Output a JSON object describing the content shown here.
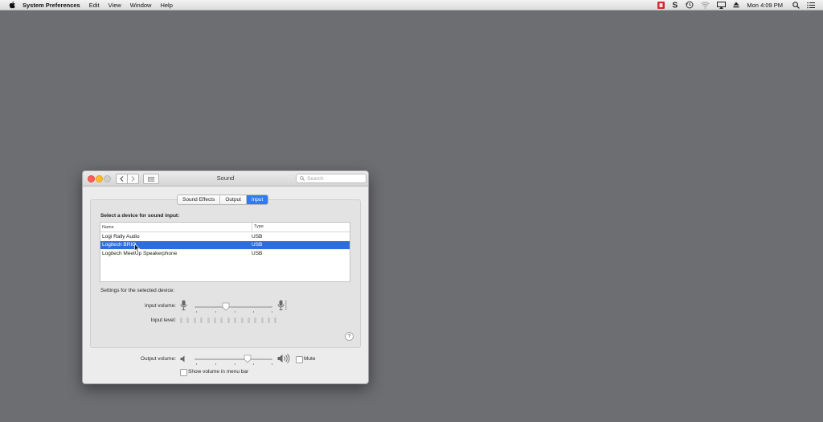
{
  "menubar": {
    "app_name": "System Preferences",
    "items": [
      "Edit",
      "View",
      "Window",
      "Help"
    ],
    "clock": "Mon 4:09 PM"
  },
  "window": {
    "title": "Sound",
    "search_placeholder": "Search",
    "tabs": [
      {
        "label": "Sound Effects",
        "active": false
      },
      {
        "label": "Output",
        "active": false
      },
      {
        "label": "Input",
        "active": true
      }
    ],
    "input": {
      "heading": "Select a device for sound input:",
      "table": {
        "columns": [
          "Name",
          "Type"
        ],
        "rows": [
          {
            "name": "Logi Rally Audio",
            "type": "USB",
            "selected": false
          },
          {
            "name": "Logitech BRIO",
            "type": "USB",
            "selected": true
          },
          {
            "name": "Logitech MeetUp Speakerphone",
            "type": "USB",
            "selected": false
          }
        ]
      },
      "settings_label": "Settings for the selected device:",
      "input_volume_label": "Input volume:",
      "input_volume": 0.4,
      "input_level_label": "Input level:",
      "input_level_segments": 15
    },
    "output_volume_label": "Output volume:",
    "output_volume": 0.68,
    "mute_label": "Mute",
    "mute_checked": false,
    "show_volume_label": "Show volume in menu bar",
    "show_volume_checked": false,
    "help_label": "?"
  },
  "colors": {
    "desktop": "#6d6e72",
    "accent": "#2e7bf5",
    "selection": "#2f6ed9"
  }
}
